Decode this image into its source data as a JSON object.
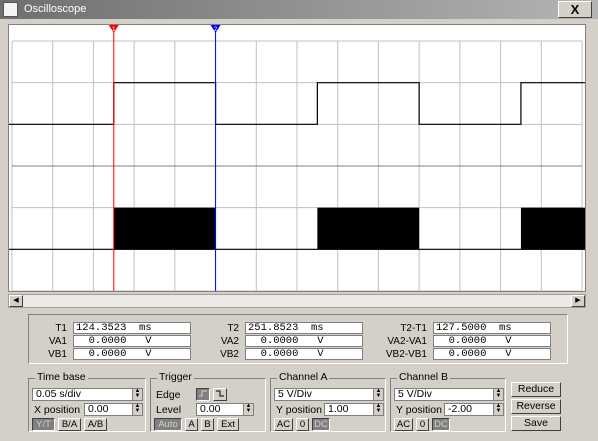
{
  "window": {
    "title": "Oscilloscope",
    "close_label": "X"
  },
  "cursors": {
    "t1_label": "1",
    "t2_label": "2"
  },
  "colors": {
    "trace": "#000000",
    "grid": "#c0c0c0",
    "cursor1": "#ff0000",
    "cursor2": "#0000ff"
  },
  "readouts": {
    "t1": {
      "label": "T1",
      "value": "124.3523  ms"
    },
    "va1": {
      "label": "VA1",
      "value": "  0.0000   V"
    },
    "vb1": {
      "label": "VB1",
      "value": "  0.0000   V"
    },
    "t2": {
      "label": "T2",
      "value": "251.8523  ms"
    },
    "va2": {
      "label": "VA2",
      "value": "  0.0000   V"
    },
    "vb2": {
      "label": "VB2",
      "value": "  0.0000   V"
    },
    "dt": {
      "label": "T2-T1",
      "value": "127.5000  ms"
    },
    "dva": {
      "label": "VA2-VA1",
      "value": "  0.0000   V"
    },
    "dvb": {
      "label": "VB2-VB1",
      "value": "  0.0000   V"
    }
  },
  "timebase": {
    "title": "Time base",
    "scale": "0.05 s/div",
    "xpos_label": "X position",
    "xpos": "0.00",
    "modes": [
      "Y/T",
      "B/A",
      "A/B"
    ]
  },
  "trigger": {
    "title": "Trigger",
    "edge_label": "Edge",
    "level_label": "Level",
    "level": "0.00",
    "sources": [
      "Auto",
      "A",
      "B",
      "Ext"
    ]
  },
  "channel_a": {
    "title": "Channel A",
    "scale": "5 V/Div",
    "ypos_label": "Y position",
    "ypos": "1.00",
    "coupling": [
      "AC",
      "0",
      "DC"
    ]
  },
  "channel_b": {
    "title": "Channel B",
    "scale": "5 V/Div",
    "ypos_label": "Y position",
    "ypos": "-2.00",
    "coupling": [
      "AC",
      "0",
      "DC"
    ]
  },
  "actions": {
    "reduce": "Reduce",
    "reverse": "Reverse",
    "save": "Save"
  }
}
